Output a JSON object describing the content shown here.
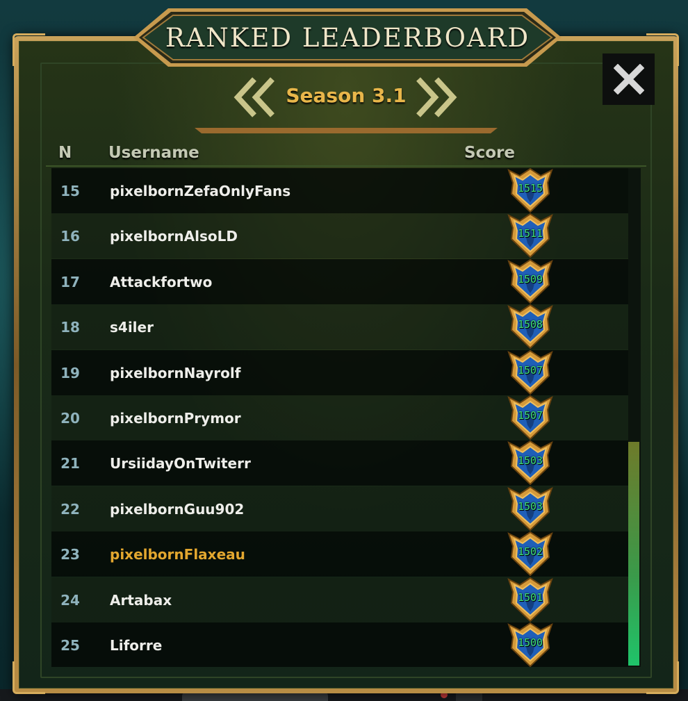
{
  "header": {
    "title": "RANKED LEADERBOARD"
  },
  "season": {
    "label": "Season 3.1",
    "prev_icon": "double-chevron-left-icon",
    "next_icon": "double-chevron-right-icon"
  },
  "close_icon": "close-x-icon",
  "columns": {
    "rank": "N",
    "username": "Username",
    "score": "Score"
  },
  "colors": {
    "accent_gold": "#e8b64a",
    "highlight_user": "#e3a72f",
    "score_text": "#3fe07a",
    "rank_text": "#8fb3bd"
  },
  "rows": [
    {
      "rank": "15",
      "username": "pixelbornZefaOnlyFans",
      "score": "1515",
      "highlight": false
    },
    {
      "rank": "16",
      "username": "pixelbornAlsoLD",
      "score": "1511",
      "highlight": false
    },
    {
      "rank": "17",
      "username": "Attackfortwo",
      "score": "1509",
      "highlight": false
    },
    {
      "rank": "18",
      "username": "s4iler",
      "score": "1508",
      "highlight": false
    },
    {
      "rank": "19",
      "username": "pixelbornNayrolf",
      "score": "1507",
      "highlight": false
    },
    {
      "rank": "20",
      "username": "pixelbornPrymor",
      "score": "1507",
      "highlight": false
    },
    {
      "rank": "21",
      "username": "UrsiidayOnTwiterr",
      "score": "1503",
      "highlight": false
    },
    {
      "rank": "22",
      "username": "pixelbornGuu902",
      "score": "1503",
      "highlight": false
    },
    {
      "rank": "23",
      "username": "pixelbornFlaxeau",
      "score": "1502",
      "highlight": true
    },
    {
      "rank": "24",
      "username": "Artabax",
      "score": "1501",
      "highlight": false
    },
    {
      "rank": "25",
      "username": "Liforre",
      "score": "1500",
      "highlight": false
    }
  ]
}
